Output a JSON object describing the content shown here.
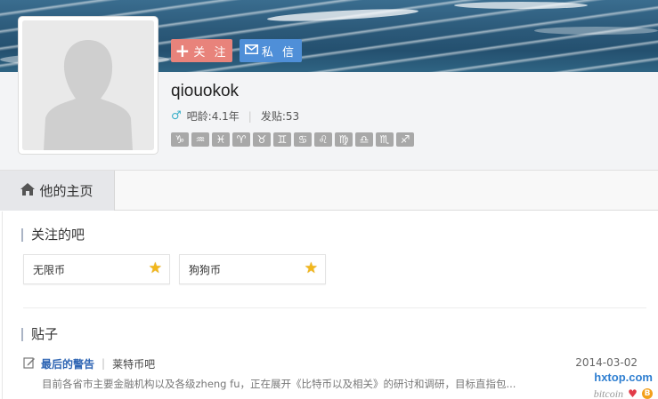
{
  "profile": {
    "follow_label": "关 注",
    "message_label": "私 信",
    "username": "qiouokok",
    "age_label": "吧龄:4.1年",
    "posts_label": "发贴:53",
    "zodiac_signs": [
      "♑",
      "♒",
      "♓",
      "♈",
      "♉",
      "♊",
      "♋",
      "♌",
      "♍",
      "♎",
      "♏",
      "♐"
    ]
  },
  "tabs": {
    "home_label": "他的主页"
  },
  "followed_bars": {
    "title": "关注的吧",
    "items": [
      {
        "name": "无限币"
      },
      {
        "name": "狗狗币"
      }
    ]
  },
  "posts": {
    "title": "贴子",
    "items": [
      {
        "title": "最后的警告",
        "forum": "莱特币吧",
        "date": "2014-03-02",
        "snippet": "目前各省市主要金融机构以及各级zheng fu，正在展开《比特币以及相关》的研讨和调研，目标直指包..."
      }
    ]
  },
  "watermark": {
    "line1": "hxtop.com",
    "line2": "bitcoin"
  },
  "colors": {
    "follow_button": "#e8837b",
    "message_button": "#4f8fd8",
    "post_title": "#2d64b3",
    "gender_icon": "#3bb0c9"
  }
}
